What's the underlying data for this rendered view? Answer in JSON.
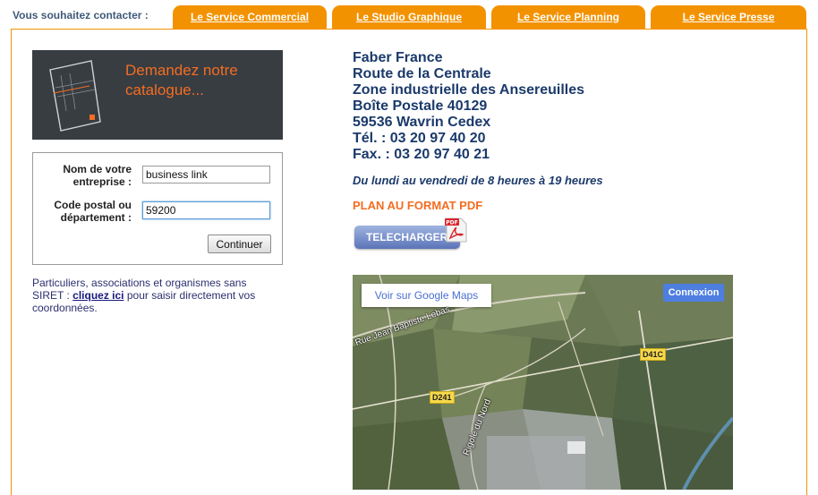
{
  "header": {
    "contact_label": "Vous souhaitez contacter :",
    "tabs": [
      {
        "label": "Le Service Commercial"
      },
      {
        "label": "Le Studio Graphique"
      },
      {
        "label": "Le Service Planning"
      },
      {
        "label": "Le Service Presse"
      }
    ]
  },
  "catalogue": {
    "banner_text": "Demandez notre catalogue...",
    "company_label": "Nom de votre entreprise :",
    "company_value": "business link",
    "postal_label": "Code postal ou département :",
    "postal_value": "59200",
    "continue_label": "Continuer",
    "note_before": "Particuliers, associations et organismes sans SIRET :",
    "note_link": "cliquez ici",
    "note_after": "pour saisir directement vos coordonnées."
  },
  "address": {
    "lines": [
      "Faber France",
      "Route de la Centrale",
      "Zone industrielle des Ansereuilles",
      "Boîte Postale 40129",
      "59536 Wavrin Cedex",
      "Tél. : 03 20 97 40 20",
      "Fax. : 03 20 97 40 21"
    ],
    "hours": "Du lundi au vendredi de 8 heures à 19 heures",
    "plan_label": "PLAN AU FORMAT PDF",
    "download_label": "TELECHARGER"
  },
  "map": {
    "view_link": "Voir sur Google Maps",
    "login": "Connexion",
    "roads": [
      "D41C",
      "D241"
    ],
    "street_labels": [
      "Rue Jean Baptiste Lebas",
      "Rigole du Nord"
    ]
  },
  "colors": {
    "accent": "#f39200",
    "banner_bg": "#383d42",
    "banner_text": "#f36d21",
    "address_text": "#1b3a6b"
  }
}
